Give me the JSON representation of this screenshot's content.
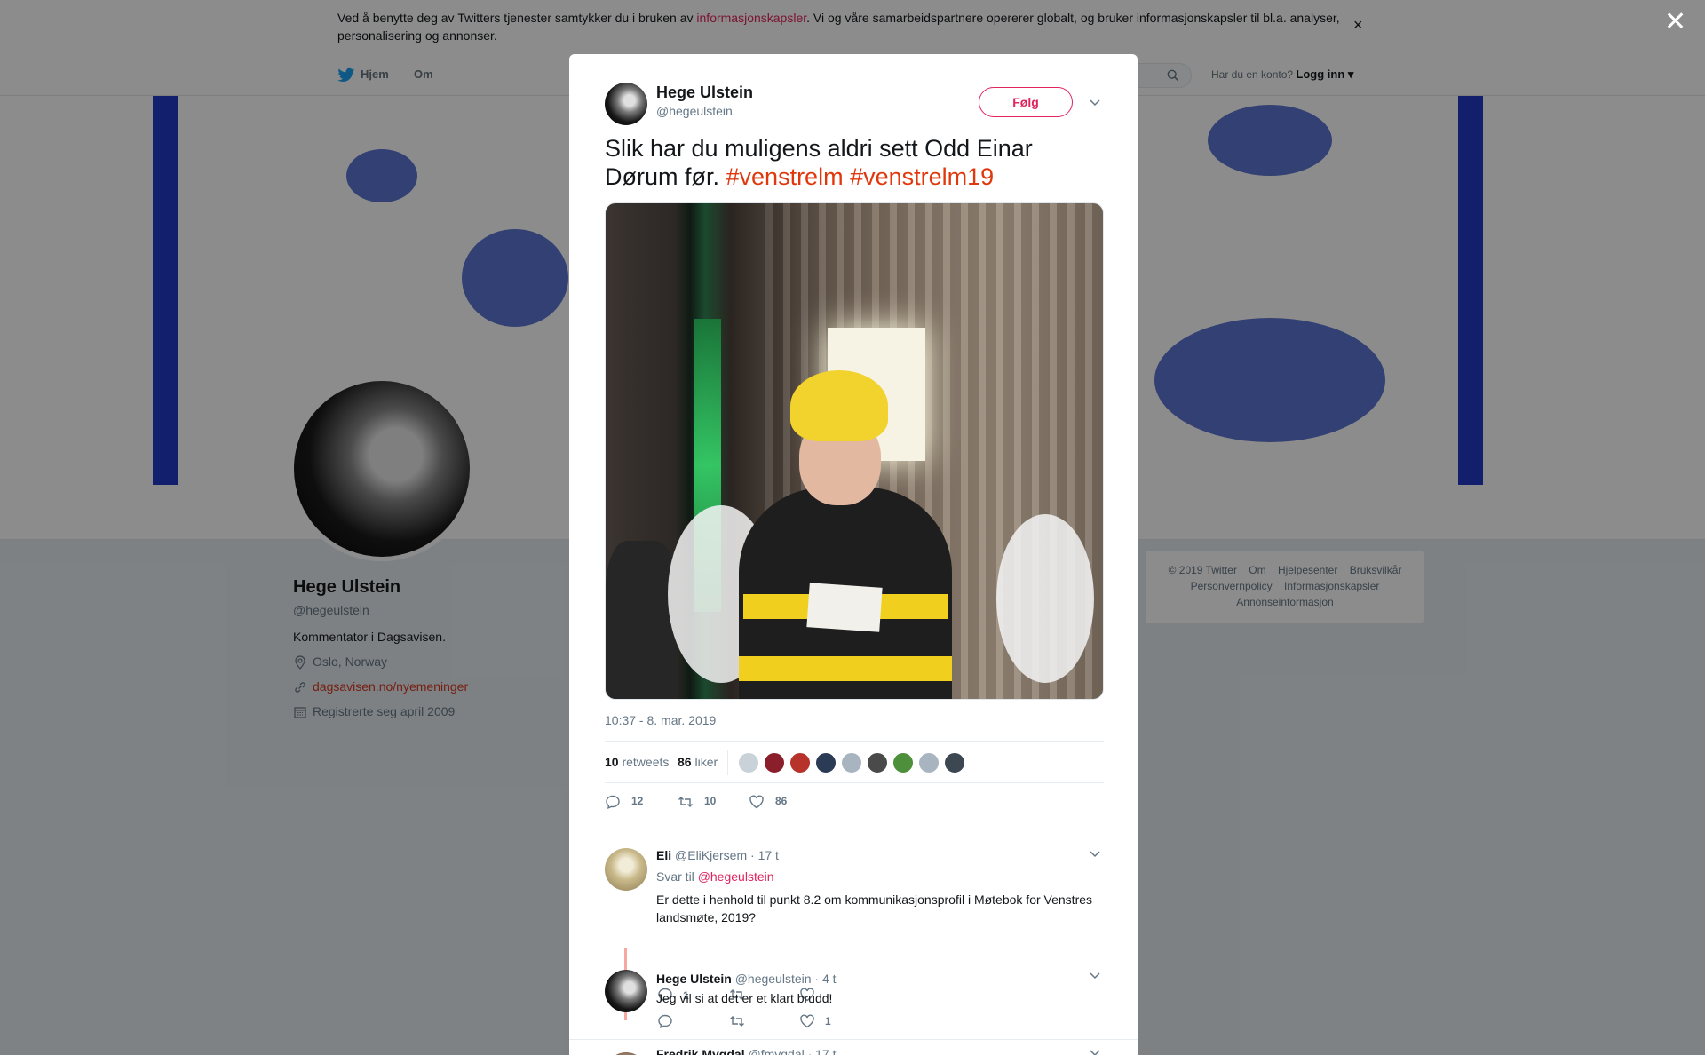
{
  "cookie": {
    "text_before": "Ved å benytte deg av Twitters tjenester samtykker du i bruken av ",
    "link": "informasjonskapsler",
    "text_after": ". Vi og våre samarbeidspartnere opererer globalt, og bruker informasjonskapsler til bl.a. analyser, personalisering og annonser.",
    "close": "×"
  },
  "nav": {
    "home": "Hjem",
    "about": "Om",
    "login_prompt": "Har du en konto?",
    "login": "Logg inn"
  },
  "overlay_close": "✕",
  "profile": {
    "name": "Hege Ulstein",
    "handle": "@hegeulstein",
    "bio": "Kommentator i Dagsavisen.",
    "location": "Oslo, Norway",
    "website": "dagsavisen.no/nyemeninger",
    "joined": "Registrerte seg april 2009"
  },
  "footer": {
    "links": [
      "© 2019 Twitter",
      "Om",
      "Hjelpesenter",
      "Bruksvilkår",
      "Personvernpolicy",
      "Informasjonskapsler",
      "Annonseinformasjon"
    ]
  },
  "tweet": {
    "author_name": "Hege Ulstein",
    "author_handle": "@hegeulstein",
    "follow": "Følg",
    "text": "Slik har du muligens aldri sett Odd Einar Dørum før.",
    "hashtag1": "#venstrelm",
    "hashtag2": "#venstrelm19",
    "timestamp": "10:37 - 8. mar. 2019",
    "retweets_count": "10",
    "retweets_label": "retweets",
    "likes_count": "86",
    "likes_label": "liker",
    "replies_action": "12",
    "retweets_action": "10",
    "likes_action": "86"
  },
  "replies": [
    {
      "name": "Eli",
      "handle": "@EliKjersem",
      "time": "· 17 t",
      "reply_to_label": "Svar til",
      "reply_to": "@hegeulstein",
      "text": "Er dette i henhold til punkt 8.2 om kommunikasjonsprofil i Møtebok for Venstres landsmøte, 2019?",
      "reply_count": "1"
    },
    {
      "name": "Hege Ulstein",
      "handle": "@hegeulstein",
      "time": "· 4 t",
      "text": "Jeg vil si at det er et klart brudd!",
      "like_count": "1"
    },
    {
      "name": "Fredrik Mygdal",
      "handle": "@fmygdal",
      "time": "· 17 t"
    }
  ],
  "colors": {
    "accent": "#e0245e",
    "hashtag": "#e0380d",
    "thread_line": "#f7a8a0",
    "banner_blue": "#1f39c6"
  }
}
